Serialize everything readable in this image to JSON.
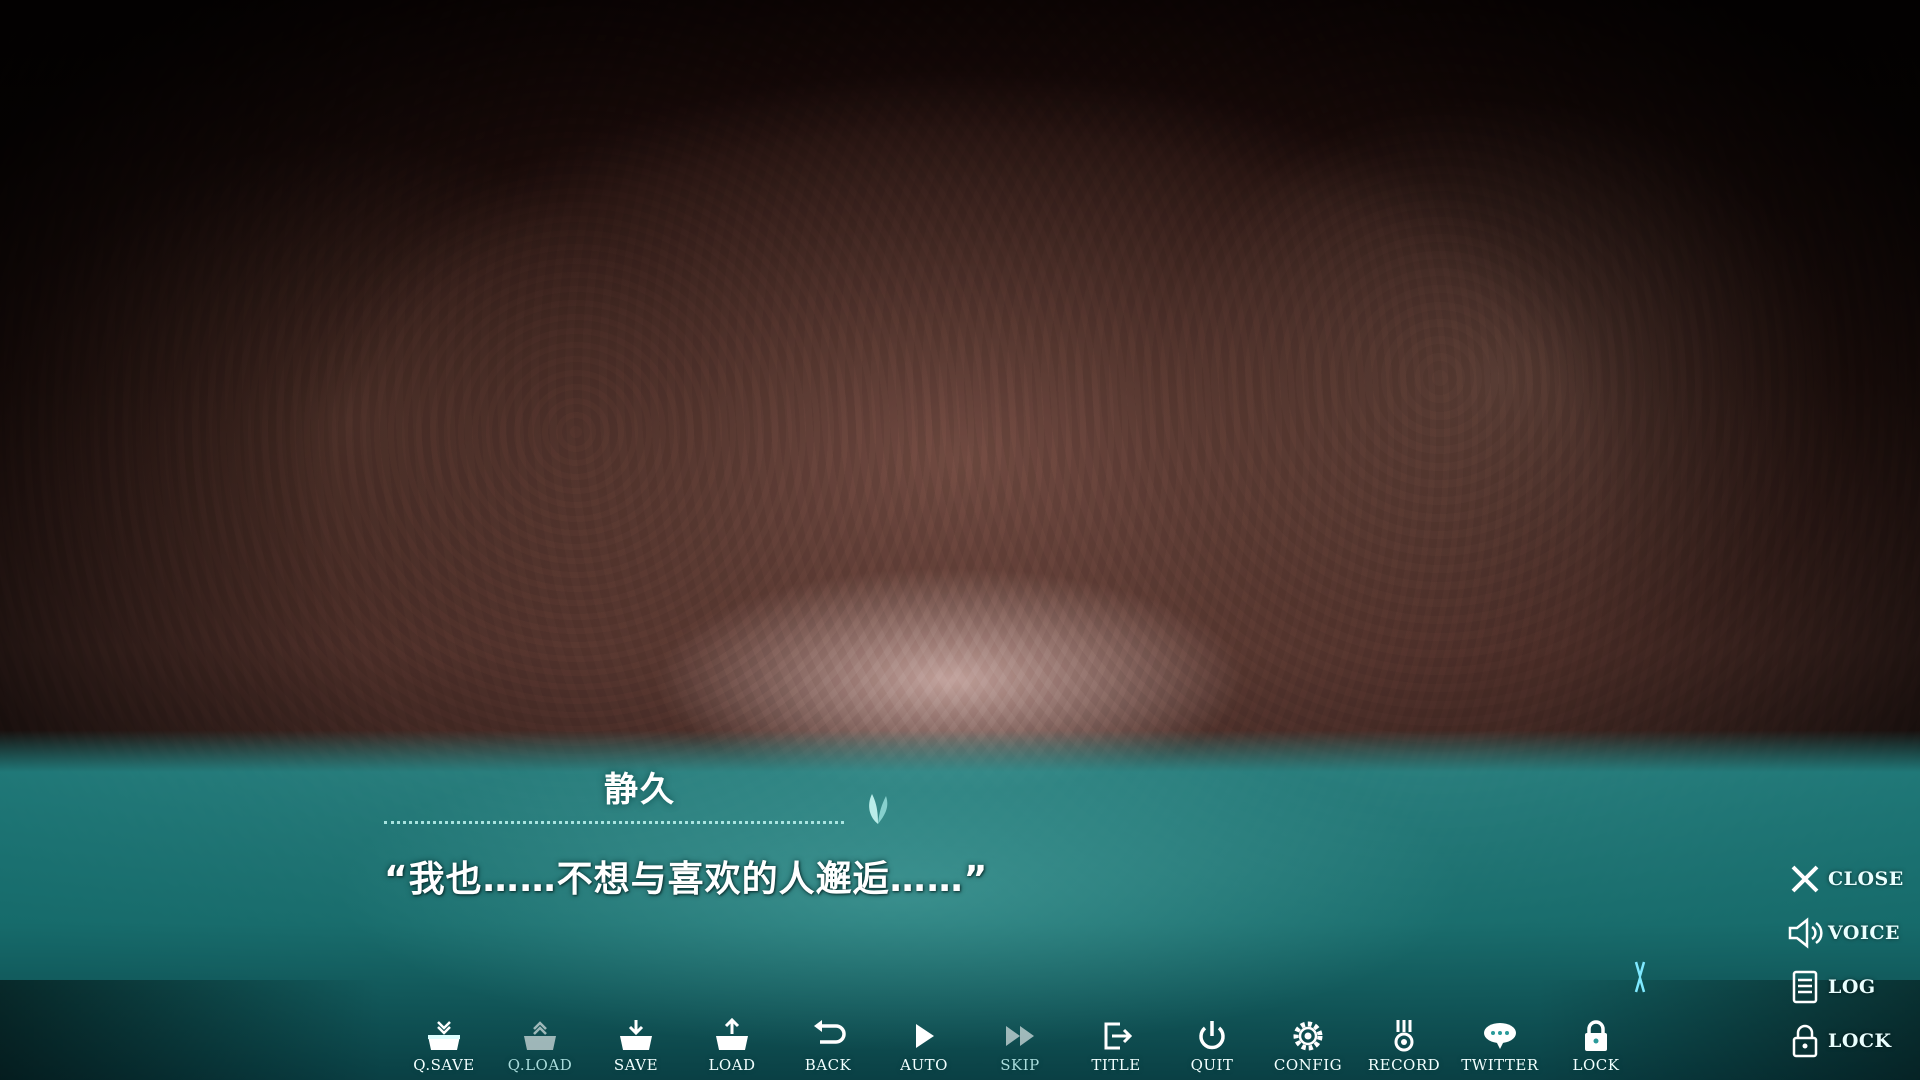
{
  "dialogue_box": {
    "speaker": "静久",
    "line": "“我也……不想与喜欢的人邂逅……”"
  },
  "toolbar": {
    "buttons": [
      {
        "label": "Q.SAVE",
        "icon": "quick-save-icon"
      },
      {
        "label": "Q.LOAD",
        "icon": "quick-load-icon"
      },
      {
        "label": "SAVE",
        "icon": "save-icon"
      },
      {
        "label": "LOAD",
        "icon": "load-icon"
      },
      {
        "label": "BACK",
        "icon": "back-arrow-icon"
      },
      {
        "label": "AUTO",
        "icon": "play-icon"
      },
      {
        "label": "SKIP",
        "icon": "fast-forward-icon"
      },
      {
        "label": "TITLE",
        "icon": "exit-to-title-icon"
      },
      {
        "label": "QUIT",
        "icon": "power-icon"
      },
      {
        "label": "CONFIG",
        "icon": "gear-icon"
      },
      {
        "label": "RECORD",
        "icon": "medal-icon"
      },
      {
        "label": "TWITTER",
        "icon": "speech-bubble-icon"
      },
      {
        "label": "LOCK",
        "icon": "lock-icon"
      }
    ]
  },
  "side_menu": {
    "buttons": [
      {
        "label": "CLOSE",
        "icon": "close-icon"
      },
      {
        "label": "VOICE",
        "icon": "speaker-icon"
      },
      {
        "label": "LOG",
        "icon": "document-icon"
      },
      {
        "label": "LOCK",
        "icon": "lock-icon"
      }
    ]
  },
  "colors": {
    "text_box": "#238f8f",
    "accent": "#bff5f0"
  }
}
